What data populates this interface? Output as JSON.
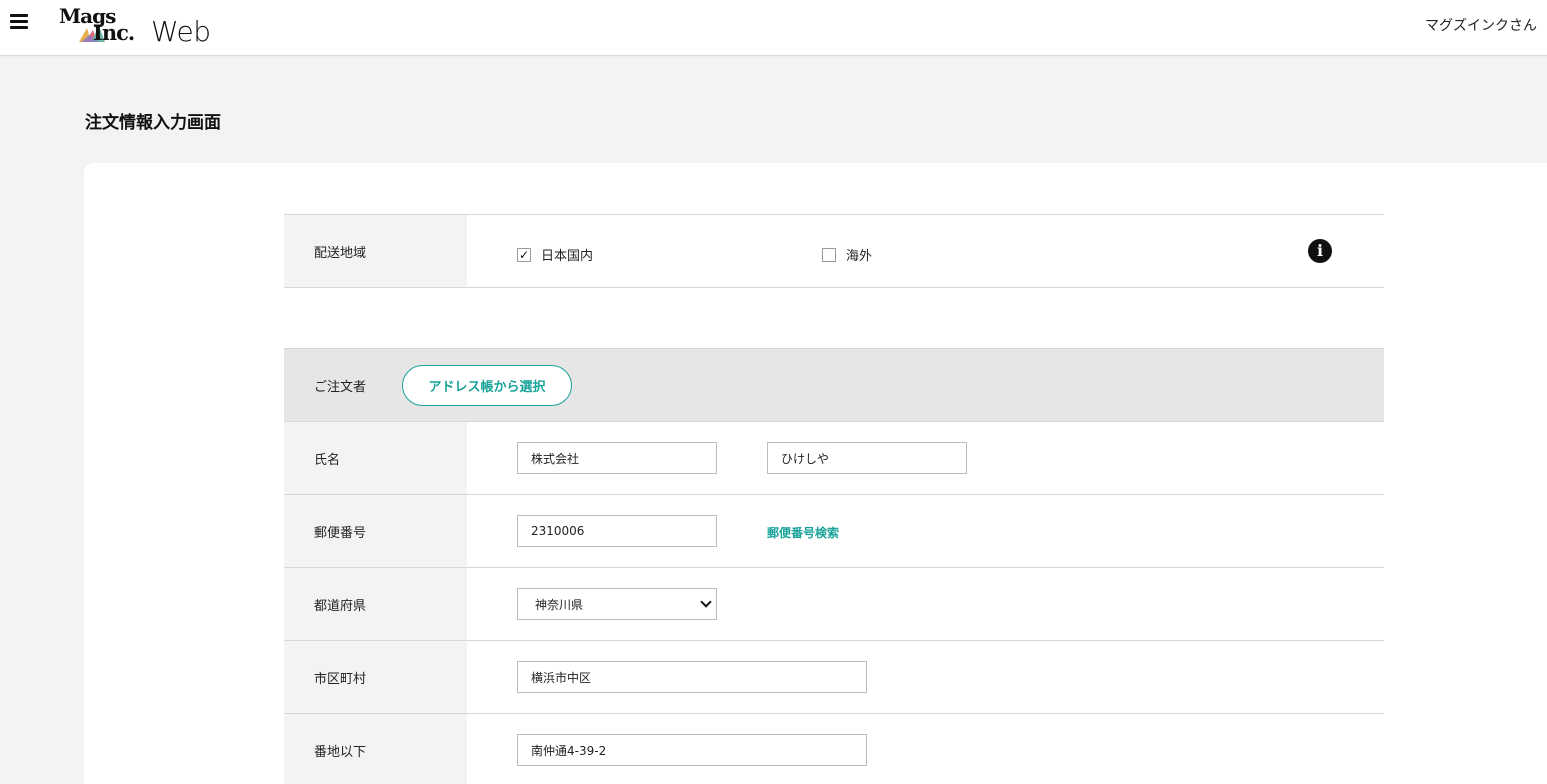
{
  "header": {
    "menu_icon": "hamburger-icon",
    "logo_top": "Mags",
    "logo_bottom": "Inc.",
    "logo_suffix": "Web",
    "user_name": "マグズインクさん"
  },
  "page": {
    "title": "注文情報入力画面"
  },
  "delivery_region": {
    "label": "配送地域",
    "options": [
      {
        "label": "日本国内",
        "checked": true
      },
      {
        "label": "海外",
        "checked": false
      }
    ],
    "info_icon": "info-icon"
  },
  "orderer": {
    "title": "ご注文者",
    "address_book_button": "アドレス帳から選択",
    "fields": {
      "name": {
        "label": "氏名",
        "last": "株式会社",
        "first": "ひけしや"
      },
      "postal": {
        "label": "郵便番号",
        "value": "2310006",
        "search_link": "郵便番号検索"
      },
      "prefecture": {
        "label": "都道府県",
        "value": "神奈川県"
      },
      "city": {
        "label": "市区町村",
        "value": "横浜市中区"
      },
      "street": {
        "label": "番地以下",
        "value": "南仲通4-39-2"
      }
    }
  },
  "colors": {
    "accent": "#1aa39a",
    "background": "#f3f3f3",
    "label_bg": "#f3f3f3",
    "section_head_bg": "#e6e6e6"
  }
}
